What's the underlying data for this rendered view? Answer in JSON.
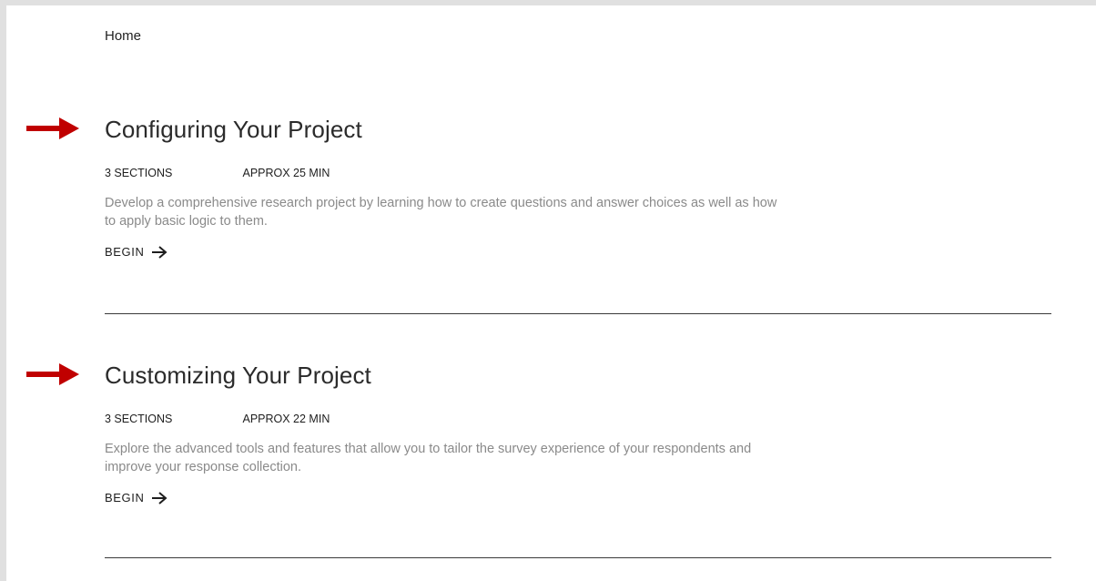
{
  "breadcrumb": {
    "home_label": "Home"
  },
  "annotation_arrow_color": "#c00000",
  "courses": [
    {
      "title": "Configuring Your Project",
      "sections": "3 SECTIONS",
      "duration": "APPROX 25 MIN",
      "description": "Develop a comprehensive research project by learning how to create questions and answer choices as well as how to apply basic logic to them.",
      "begin_label": "BEGIN",
      "begin_icon": "arrow-right-icon"
    },
    {
      "title": "Customizing Your Project",
      "sections": "3 SECTIONS",
      "duration": "APPROX 22 MIN",
      "description": "Explore the advanced tools and features that allow you to tailor the survey experience of your respondents and improve your response collection.",
      "begin_label": "BEGIN",
      "begin_icon": "arrow-right-icon"
    }
  ]
}
